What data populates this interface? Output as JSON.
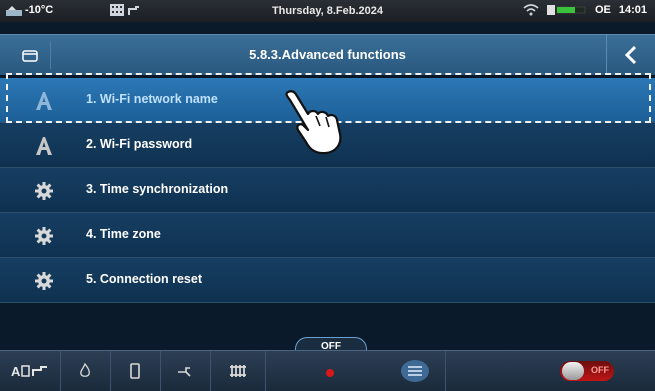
{
  "status": {
    "outside_temp": "-10°C",
    "date": "Thursday, 8.Feb.2024",
    "mode": "OE",
    "time": "14:01"
  },
  "header": {
    "title": "5.8.3.Advanced functions"
  },
  "menu": {
    "items": [
      {
        "label": "1. Wi-Fi network name",
        "icon": "font-a-icon",
        "selected": true
      },
      {
        "label": "2. Wi-Fi password",
        "icon": "font-a-icon",
        "selected": false
      },
      {
        "label": "3. Time synchronization",
        "icon": "gear-icon",
        "selected": false
      },
      {
        "label": "4. Time zone",
        "icon": "gear-icon",
        "selected": false
      },
      {
        "label": "5. Connection reset",
        "icon": "gear-icon",
        "selected": false
      }
    ]
  },
  "bottom": {
    "off_label": "OFF",
    "toggle_label": "OFF"
  },
  "colors": {
    "header": "#2f6790",
    "row": "#123a5c",
    "row_selected": "#2470ad",
    "toggle_off": "#c01616"
  }
}
